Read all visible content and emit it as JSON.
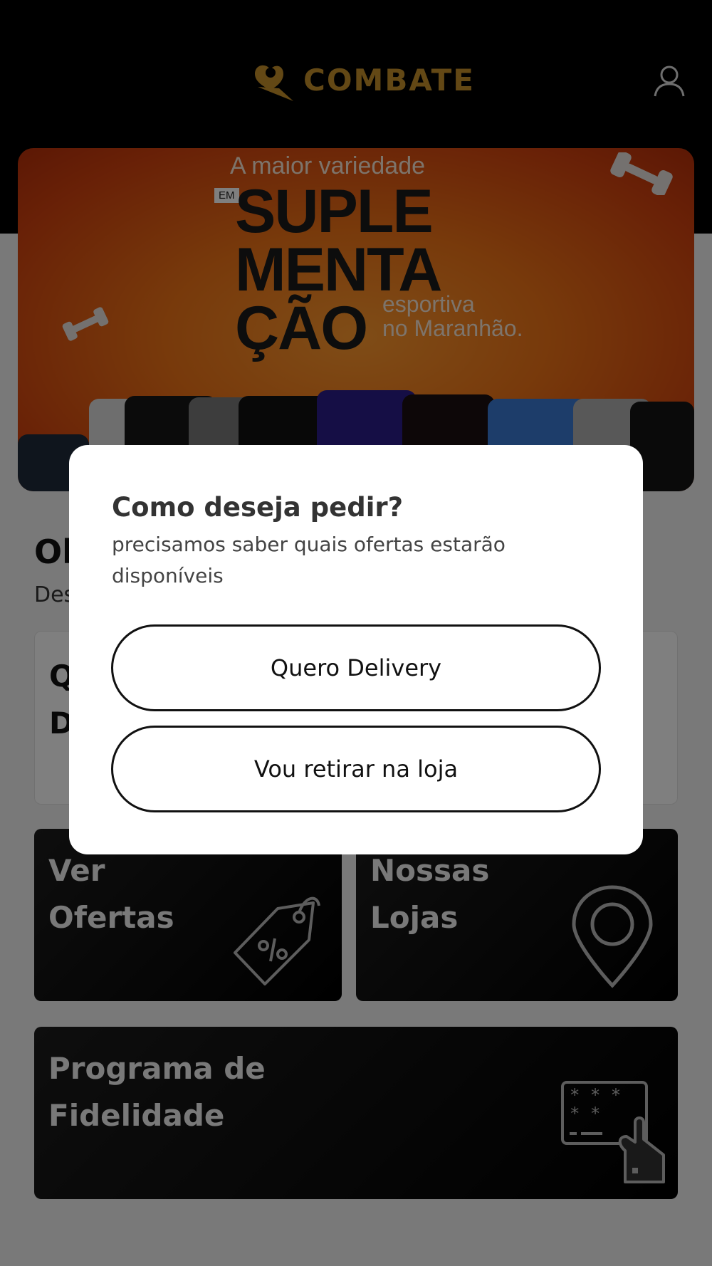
{
  "header": {
    "logo_text": "COMBATE"
  },
  "banner": {
    "headline_top": "A maior variedade",
    "em_label": "EM",
    "headline_big": [
      "SUPLE",
      "MENTA",
      "ÇÃO"
    ],
    "headline_side": [
      "esportiva",
      "no Maranhão."
    ]
  },
  "main": {
    "welcome_title": "Ol",
    "welcome_sub": "Des",
    "info_card_lines": [
      "Q",
      "D"
    ]
  },
  "tiles": {
    "offers": [
      "Ver",
      "Ofertas"
    ],
    "stores": [
      "Nossas",
      "Lojas"
    ],
    "loyalty": [
      "Programa de",
      "Fidelidade"
    ]
  },
  "modal": {
    "title": "Como deseja pedir?",
    "subtitle": "precisamos saber quais ofertas estarão disponíveis",
    "delivery_label": "Quero Delivery",
    "pickup_label": "Vou retirar na loja"
  },
  "colors": {
    "brand_gold": "#c6902b",
    "banner_orange": "#f07417",
    "overlay": "rgba(0,0,0,0.5)"
  },
  "icons": [
    "logo-heart-icon",
    "user-icon",
    "price-tag-icon",
    "map-pin-icon",
    "loyalty-card-icon",
    "dumbbell-icon"
  ]
}
